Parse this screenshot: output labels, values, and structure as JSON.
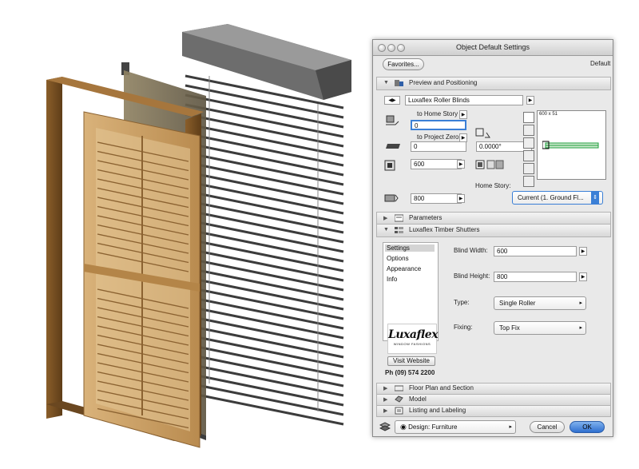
{
  "dialog": {
    "title": "Object Default Settings",
    "favorites_label": "Favorites...",
    "default_label": "Default",
    "preview_section": "Preview and Positioning",
    "library_part_name": "Luxaflex Roller Blinds",
    "home_story_offset_label": "to Home Story",
    "home_story_offset_value": "0",
    "project_zero_label": "to Project Zero",
    "project_zero_value": "0",
    "angle_value": "0.0000°",
    "width_value": "600",
    "height_value": "800",
    "preview_caption": "600 x 51",
    "home_story_label": "Home Story:",
    "home_story_value": "Current (1. Ground Fl...",
    "parameters_section": "Parameters",
    "timber_section": "Luxaflex Timber Shutters",
    "settings_tabs": [
      "Settings",
      "Options",
      "Appearance",
      "Info"
    ],
    "blind_width_label": "Blind Width:",
    "blind_width_value": "600",
    "blind_height_label": "Blind Height:",
    "blind_height_value": "800",
    "type_label": "Type:",
    "type_value": "Single Roller",
    "fixing_label": "Fixing:",
    "fixing_value": "Top Fix",
    "logo_text": "Luxaflex",
    "logo_subtext": "WINDOW FASHIONS",
    "visit_website_label": "Visit Website",
    "phone": "Ph (09) 574 2200",
    "floor_plan_section": "Floor Plan and Section",
    "model_section": "Model",
    "listing_section": "Listing and Labeling",
    "design_label": "Design: Furniture",
    "cancel_label": "Cancel",
    "ok_label": "OK"
  },
  "colors": {
    "accent_blue": "#3a7fd6",
    "timber": "#c9a06a",
    "timber_dark": "#6b4a22",
    "blind_slat": "#555555",
    "roller_fabric": "#7a6d55"
  },
  "icons": {
    "preview_icon": "object-settings-icon",
    "timber_icon": "parameters-list-icon",
    "eye": "eye-icon"
  }
}
